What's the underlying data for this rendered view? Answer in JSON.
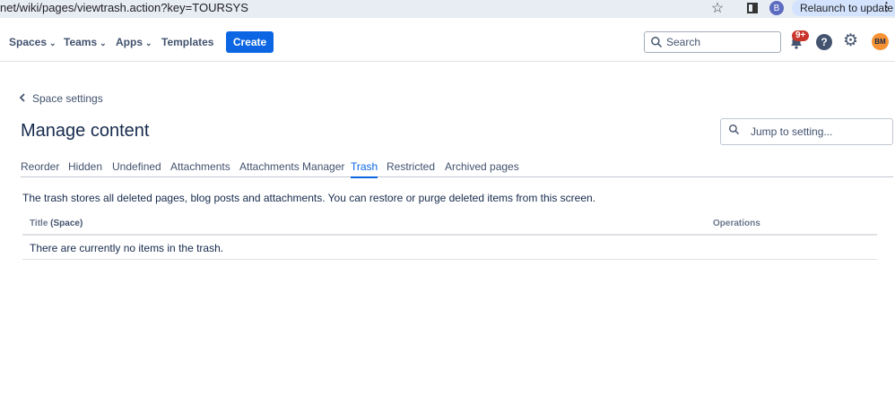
{
  "browser": {
    "url": "net/wiki/pages/viewtrash.action?key=TOURSYS",
    "profile_initial": "B",
    "relaunch_label": "Relaunch to update",
    "kebab": "⋮",
    "star": "☆"
  },
  "nav": {
    "spaces": "Spaces",
    "teams": "Teams",
    "apps": "Apps",
    "templates": "Templates",
    "create": "Create",
    "search_placeholder": "Search",
    "notification_badge": "9+",
    "help": "?",
    "gear": "⚙",
    "avatar_initials": "BM",
    "chevron": "⌄"
  },
  "page": {
    "back_label": "Space settings",
    "title": "Manage content",
    "jump_placeholder": "Jump to setting..."
  },
  "tabs": [
    {
      "label": "Reorder",
      "active": false
    },
    {
      "label": "Hidden",
      "active": false
    },
    {
      "label": "Undefined",
      "active": false
    },
    {
      "label": "Attachments",
      "active": false
    },
    {
      "label": "Attachments Manager",
      "active": false
    },
    {
      "label": "Trash",
      "active": true
    },
    {
      "label": "Restricted",
      "active": false
    },
    {
      "label": "Archived pages",
      "active": false
    }
  ],
  "trash": {
    "description": "The trash stores all deleted pages, blog posts and attachments. You can restore or purge deleted items from this screen.",
    "col_title": "Title",
    "col_space": "(Space)",
    "col_operations": "Operations",
    "empty_message": "There are currently no items in the trash."
  },
  "colors": {
    "accent": "#0c66e4",
    "badge": "#c9372c",
    "avatar": "#f79232"
  }
}
